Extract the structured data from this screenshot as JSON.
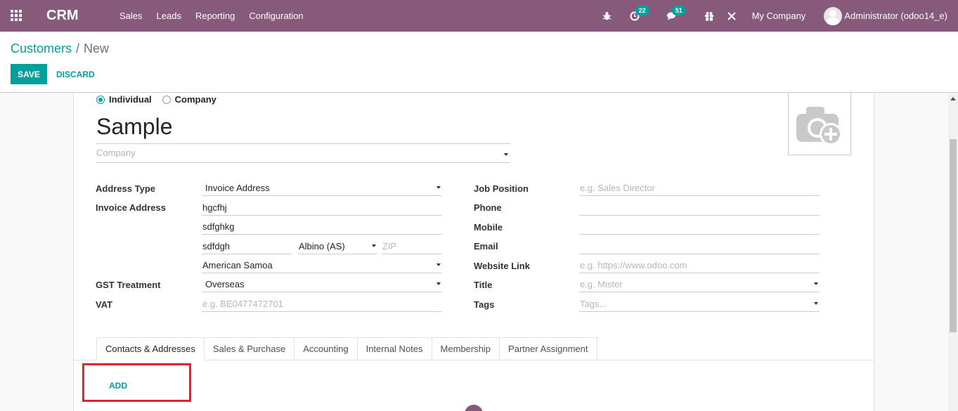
{
  "navbar": {
    "brand": "CRM",
    "menu": [
      "Sales",
      "Leads",
      "Reporting",
      "Configuration"
    ],
    "activity_count": "22",
    "message_count": "51",
    "company": "My Company",
    "user": "Administrator (odoo14_e)"
  },
  "control_panel": {
    "breadcrumb_parent": "Customers",
    "breadcrumb_separator": "/",
    "breadcrumb_current": "New",
    "save_label": "SAVE",
    "discard_label": "DISCARD"
  },
  "form": {
    "type_individual": "Individual",
    "type_company": "Company",
    "selected_type": "Individual",
    "name": "Sample",
    "company_placeholder": "Company",
    "left": {
      "address_type_label": "Address Type",
      "address_type_value": "Invoice Address",
      "invoice_address_label": "Invoice Address",
      "street": "hgcfhj",
      "street2": "sdfghkg",
      "city": "sdfdgh",
      "state": "Albino (AS)",
      "zip_placeholder": "ZIP",
      "country": "American Samoa",
      "gst_label": "GST Treatment",
      "gst_value": "Overseas",
      "vat_label": "VAT",
      "vat_placeholder": "e.g. BE0477472701"
    },
    "right": {
      "job_label": "Job Position",
      "job_placeholder": "e.g. Sales Director",
      "phone_label": "Phone",
      "mobile_label": "Mobile",
      "email_label": "Email",
      "website_label": "Website Link",
      "website_placeholder": "e.g. https://www.odoo.com",
      "title_label": "Title",
      "title_placeholder": "e.g. Mister",
      "tags_label": "Tags",
      "tags_placeholder": "Tags..."
    }
  },
  "tabs": [
    "Contacts & Addresses",
    "Sales & Purchase",
    "Accounting",
    "Internal Notes",
    "Membership",
    "Partner Assignment"
  ],
  "active_tab": "Contacts & Addresses",
  "add_label": "ADD",
  "colors": {
    "navbar": "#875a7b",
    "accent": "#00a09d",
    "highlight": "#e1232b"
  }
}
